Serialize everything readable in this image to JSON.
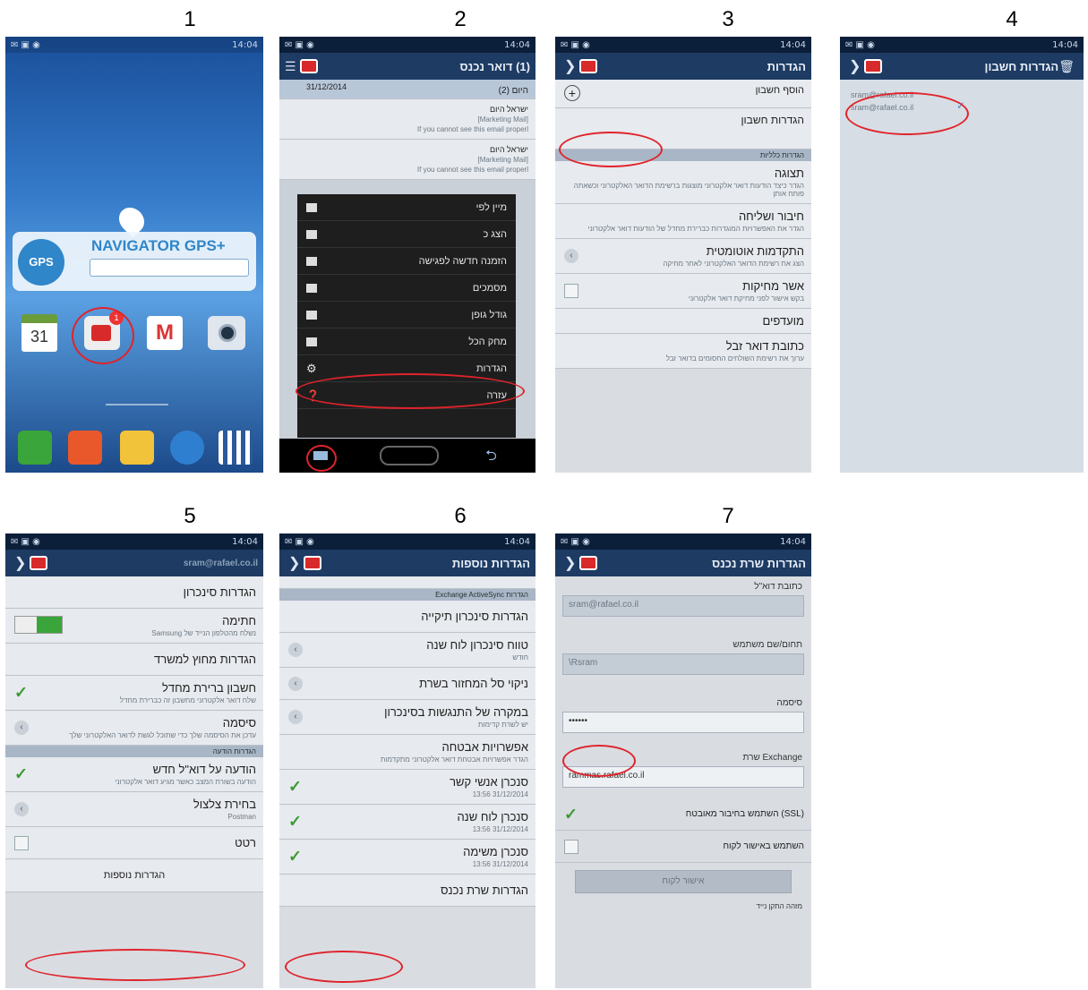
{
  "steps": [
    "1",
    "2",
    "3",
    "4",
    "5",
    "6",
    "7"
  ],
  "status": {
    "time": "14:04",
    "signal": "▲◢ ▮"
  },
  "home": {
    "gps_brand": "NAVIGATOR GPS+",
    "gps_logo": "GPS",
    "calendar_day": "31",
    "app_labels": [
      "",
      "",
      "Gmail",
      ""
    ]
  },
  "screen2": {
    "title": "(1) דואר נכנס",
    "sub": "",
    "date_row": "31/12/2014",
    "group": "היום (2)",
    "emails": [
      {
        "from": "ישראל היום",
        "subject": "[Marketing Mail]",
        "preview": "If you cannot see this email properl"
      },
      {
        "from": "ישראל היום",
        "subject": "[Marketing Mail]",
        "preview": "If you cannot see this email properl"
      }
    ],
    "menu": [
      "מיין לפי",
      "הצג כ",
      "הזמנה חדשה לפגישה",
      "מסמכים",
      "גודל גופן",
      "מחק הכל",
      "הגדרות",
      "עזרה"
    ]
  },
  "screen3": {
    "title": "הגדרות",
    "add_account": "הוסף חשבון",
    "account_settings": "הגדרות חשבון",
    "section": "הגדרות כלליות",
    "items": [
      {
        "t": "תצוגה",
        "s": "הגדר כיצד הודעות דואר אלקטרוני מוצגות ברשימת הדואר האלקטרוני וכשאתה פותח אותן"
      },
      {
        "t": "חיבור ושליחה",
        "s": "הגדר את האפשרויות המוגדרות כברירת מחדל של הודעות דואר אלקטרוני"
      },
      {
        "t": "התקדמות אוטומטית",
        "s": "הצג את רשימת הדואר האלקטרוני לאחר מחיקה"
      },
      {
        "t": "אשר מחיקות",
        "s": "בקש אישור לפני מחיקת דואר אלקטרוני"
      },
      {
        "t": "מועדפים",
        "s": ""
      },
      {
        "t": "כתובת דואר זבל",
        "s": "ערוך את רשימת השולחים החסומים בדואר זבל"
      }
    ]
  },
  "screen4": {
    "title": "הגדרות חשבון",
    "accounts": [
      "sram@rafael.co.il",
      "sram@rafael.co.il"
    ]
  },
  "screen5": {
    "title": "sram@rafael.co.il",
    "items": [
      {
        "t": "הגדרות סינכרון",
        "s": ""
      },
      {
        "t": "חתימה",
        "s": "נשלח מהטלפון הנייד של Samsung"
      },
      {
        "t": "הגדרות מחוץ למשרד",
        "s": ""
      },
      {
        "t": "חשבון ברירת מחדל",
        "s": "שלח דואר אלקטרוני מחשבון זה כברירת מחדל"
      },
      {
        "t": "סיסמה",
        "s": "עדכן את הסיסמה שלך כדי שתוכל לגשת לדואר האלקטרוני שלך"
      }
    ],
    "section": "הגדרות הודעה",
    "items2": [
      {
        "t": "הודעה על דוא\"ל חדש",
        "s": "הודעה בשורת המצב כאשר מגיע דואר אלקטרוני"
      },
      {
        "t": "בחירת צלצול",
        "s": "Postman"
      },
      {
        "t": "רטט",
        "s": ""
      }
    ],
    "more": "הגדרות נוספות"
  },
  "screen6": {
    "title": "הגדרות נוספות",
    "top": "",
    "section": "הגדרות Exchange ActiveSync",
    "items": [
      {
        "t": "הגדרות סינכרון תיקייה",
        "s": ""
      },
      {
        "t": "טווח סינכרון לוח שנה",
        "s": "חודש"
      },
      {
        "t": "ניקוי סל המחזור בשרת",
        "s": ""
      },
      {
        "t": "במקרה של התנגשות בסינכרון",
        "s": "יש לשרת קדימות"
      },
      {
        "t": "אפשרויות אבטחה",
        "s": "הגדר אפשרויות אבטחת דואר אלקטרוני מתקדמות"
      },
      {
        "t": "סנכרן אנשי קשר",
        "s": "31/12/2014 13:56"
      },
      {
        "t": "סנכרן לוח שנה",
        "s": "31/12/2014 13:56"
      },
      {
        "t": "סנכרן משימה",
        "s": "31/12/2014 13:56"
      }
    ],
    "incoming": "הגדרות שרת נכנס"
  },
  "screen7": {
    "title": "הגדרות שרת נכנס",
    "email_label": "כתובת דוא\"ל",
    "email_value": "sram@rafael.co.il",
    "user_label": "תחום/שם משתמש",
    "user_value": "\\Rsram",
    "password_label": "סיסמה",
    "password_value": "••••••",
    "server_label": "Exchange שרת",
    "server_value": "rammas.rafael.co.il",
    "ssl_label": "(SSL) השתמש בחיבור מאובטח",
    "client_cert_label": "השתמש באישור לקוח",
    "client_cert_btn": "אישור לקוח",
    "mobile_id": "מזהה התקן נייד"
  },
  "icons": [
    "mail-icon",
    "gear-icon",
    "phone-icon",
    "contacts-icon",
    "messages-icon",
    "browser-icon",
    "apps-icon"
  ]
}
